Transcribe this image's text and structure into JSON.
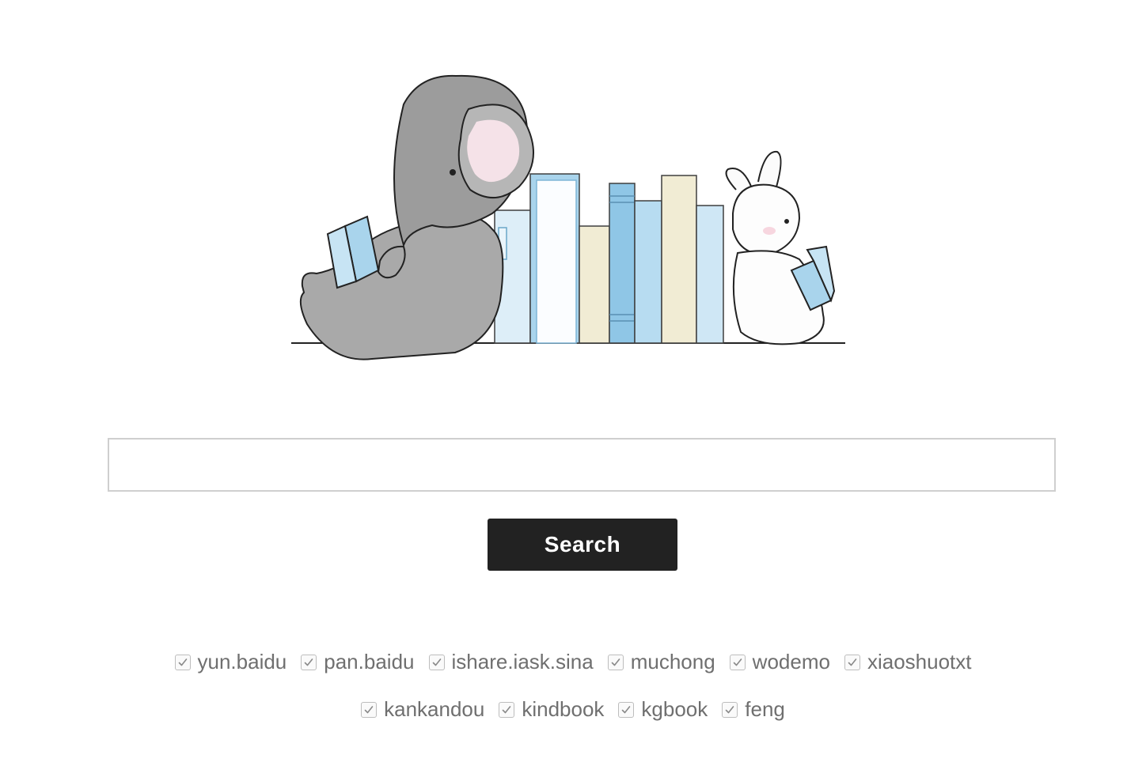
{
  "illustration": {
    "name": "elephant-and-rabbit-reading-books-illustration"
  },
  "search": {
    "value": "",
    "placeholder": "",
    "button_label": "Search"
  },
  "sources": {
    "row1": [
      {
        "label": "yun.baidu",
        "checked": true
      },
      {
        "label": "pan.baidu",
        "checked": true
      },
      {
        "label": "ishare.iask.sina",
        "checked": true
      },
      {
        "label": "muchong",
        "checked": true
      },
      {
        "label": "wodemo",
        "checked": true
      },
      {
        "label": "xiaoshuotxt",
        "checked": true
      }
    ],
    "row2": [
      {
        "label": "kankandou",
        "checked": true
      },
      {
        "label": "kindbook",
        "checked": true
      },
      {
        "label": "kgbook",
        "checked": true
      },
      {
        "label": "feng",
        "checked": true
      }
    ]
  },
  "colors": {
    "button_bg": "#222222",
    "button_text": "#ffffff",
    "input_border": "#cfcfcf",
    "label_text": "#6f6f6f",
    "book_blue": "#a9d4ec",
    "book_cream": "#f1ecd4",
    "elephant_gray": "#a9a9a9"
  }
}
